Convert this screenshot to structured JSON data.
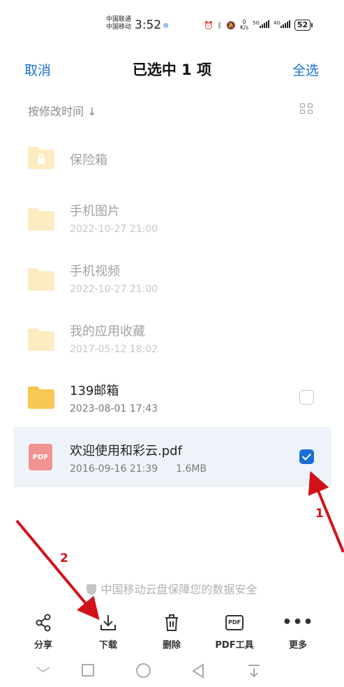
{
  "status_bar": {
    "carrier_top": "中国联通",
    "carrier_bottom": "中国移动",
    "time": "3:52",
    "net_speed_value": "0",
    "net_speed_unit": "K/s",
    "net_5g": "5G",
    "net_4g": "4G",
    "battery": "52"
  },
  "header": {
    "cancel_label": "取消",
    "title": "已选中 1 项",
    "select_all_label": "全选"
  },
  "sort": {
    "label": "按修改时间 ↓"
  },
  "files": [
    {
      "name": "保险箱",
      "date": "",
      "size": "",
      "type": "vault",
      "dimmed": true
    },
    {
      "name": "手机图片",
      "date": "2022-10-27 21:00",
      "size": "",
      "type": "folder",
      "dimmed": true
    },
    {
      "name": "手机视频",
      "date": "2022-10-27 21:00",
      "size": "",
      "type": "folder",
      "dimmed": true
    },
    {
      "name": "我的应用收藏",
      "date": "2017-05-12 18:02",
      "size": "",
      "type": "folder",
      "dimmed": true
    },
    {
      "name": "139邮箱",
      "date": "2023-08-01 17:43",
      "size": "",
      "type": "folder",
      "dimmed": false,
      "checked": false
    },
    {
      "name": "欢迎使用和彩云.pdf",
      "date": "2016-09-16 21:39",
      "size": "1.6MB",
      "type": "pdf",
      "dimmed": false,
      "checked": true
    }
  ],
  "pdf_badge": "PDF",
  "security_note": "中国移动云盘保障您的数据安全",
  "toolbar": {
    "share": "分享",
    "download": "下载",
    "delete": "删除",
    "pdf_tools": "PDF工具",
    "pdf_icon_text": "PDF",
    "more": "更多"
  },
  "annotations": {
    "step1": "1",
    "step2": "2"
  },
  "colors": {
    "accent": "#1a6fd6",
    "folder": "#f7c953",
    "annotation": "#d3111a"
  }
}
